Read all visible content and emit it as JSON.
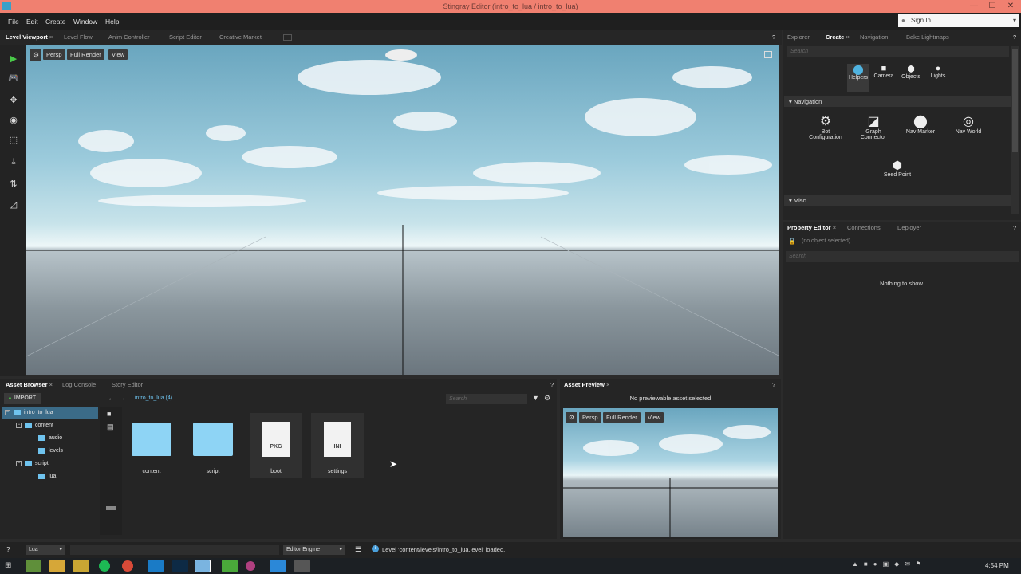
{
  "window": {
    "title": "Stingray Editor (intro_to_lua / intro_to_lua)",
    "minimize": "—",
    "maximize": "☐",
    "close": "✕"
  },
  "menu": [
    "File",
    "Edit",
    "Create",
    "Window",
    "Help"
  ],
  "signin": {
    "label": "Sign In"
  },
  "viewport": {
    "tabs": [
      "Level Viewport",
      "Level Flow",
      "Anim Controller",
      "Script Editor",
      "Creative Market"
    ],
    "buttons": {
      "persp": "Persp",
      "full_render": "Full Render",
      "view": "View"
    },
    "help": "?"
  },
  "right_top": {
    "tabs": [
      "Explorer",
      "Create",
      "Navigation",
      "Bake Lightmaps"
    ],
    "search_placeholder": "Search",
    "categories": [
      "Helpers",
      "Camera",
      "Objects",
      "Lights"
    ],
    "section_navigation": "Navigation",
    "nav_items": [
      {
        "label": "Bot Configuration"
      },
      {
        "label": "Graph Connector"
      },
      {
        "label": "Nav Marker"
      },
      {
        "label": "Nav World"
      },
      {
        "label": "Seed Point"
      }
    ],
    "section_misc": "Misc"
  },
  "property": {
    "tabs": [
      "Property Editor",
      "Connections",
      "Deployer"
    ],
    "no_object": "(no object selected)",
    "search_placeholder": "Search",
    "empty": "Nothing to show"
  },
  "asset_browser": {
    "tabs": [
      "Asset Browser",
      "Log Console",
      "Story Editor"
    ],
    "import": "IMPORT",
    "breadcrumb": "intro_to_lua (4)",
    "search_placeholder": "Search",
    "tree": [
      {
        "label": "intro_to_lua"
      },
      {
        "label": "content"
      },
      {
        "label": "audio"
      },
      {
        "label": "levels"
      },
      {
        "label": "script"
      },
      {
        "label": "lua"
      }
    ],
    "items": [
      {
        "label": "content",
        "kind": "folder"
      },
      {
        "label": "script",
        "kind": "folder"
      },
      {
        "label": "boot",
        "kind": "PKG"
      },
      {
        "label": "settings",
        "kind": "INI"
      }
    ]
  },
  "asset_preview": {
    "tab": "Asset Preview",
    "message": "No previewable asset selected",
    "buttons": {
      "persp": "Persp",
      "full_render": "Full Render",
      "view": "View"
    }
  },
  "statusbar": {
    "help": "?",
    "language": "Lua",
    "engine": "Editor Engine",
    "message": "Level 'content/levels/intro_to_lua.level' loaded."
  },
  "taskbar": {
    "time": "4:54 PM"
  }
}
